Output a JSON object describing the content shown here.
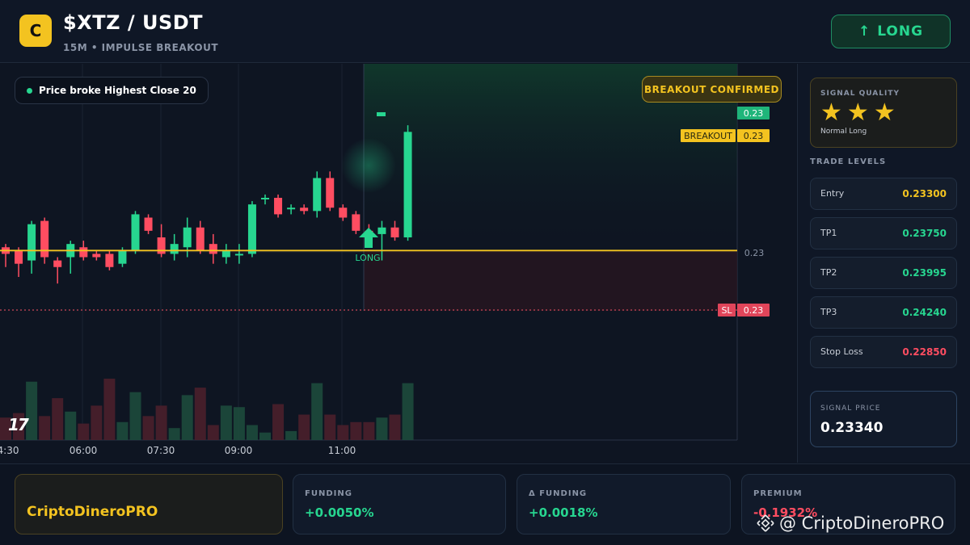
{
  "header": {
    "logo_letter": "C",
    "pair": "$XTZ / USDT",
    "subtitle": "15M • IMPULSE BREAKOUT",
    "long_button": "LONG",
    "long_arrow": "↑"
  },
  "chart": {
    "info_pill": "Price broke Highest Close 20",
    "confirmed_badge": "BREAKOUT CONFIRMED",
    "tv_logo": "17",
    "price_labels": {
      "top": "0.23",
      "breakout_tag": "BREAKOUT",
      "breakout": "0.23",
      "mid": "0.23",
      "sl_tag": "SL",
      "sl": "0.23"
    },
    "long_marker": "LONG",
    "time_labels": [
      "4:30",
      "06:00",
      "07:30",
      "09:00",
      "11:00"
    ]
  },
  "chart_data": {
    "type": "candlestick",
    "x": [
      "4:30",
      "06:00",
      "07:30",
      "09:00",
      "11:00"
    ],
    "series": [
      {
        "values": [
          {
            "o": 0.23305,
            "h": 0.2331,
            "l": 0.23275,
            "c": 0.23295
          },
          {
            "o": 0.233,
            "h": 0.23305,
            "l": 0.2326,
            "c": 0.2328
          },
          {
            "o": 0.23285,
            "h": 0.23345,
            "l": 0.23265,
            "c": 0.2334
          },
          {
            "o": 0.23345,
            "h": 0.2335,
            "l": 0.2328,
            "c": 0.2329
          },
          {
            "o": 0.23285,
            "h": 0.2329,
            "l": 0.2325,
            "c": 0.23275
          },
          {
            "o": 0.2329,
            "h": 0.23315,
            "l": 0.23265,
            "c": 0.2331
          },
          {
            "o": 0.23305,
            "h": 0.23315,
            "l": 0.23285,
            "c": 0.2329
          },
          {
            "o": 0.23295,
            "h": 0.233,
            "l": 0.23285,
            "c": 0.2329
          },
          {
            "o": 0.23295,
            "h": 0.233,
            "l": 0.2327,
            "c": 0.23275
          },
          {
            "o": 0.2328,
            "h": 0.23305,
            "l": 0.23275,
            "c": 0.233
          },
          {
            "o": 0.233,
            "h": 0.2336,
            "l": 0.23295,
            "c": 0.23355
          },
          {
            "o": 0.2335,
            "h": 0.23355,
            "l": 0.23325,
            "c": 0.2333
          },
          {
            "o": 0.2332,
            "h": 0.2334,
            "l": 0.2329,
            "c": 0.23295
          },
          {
            "o": 0.23295,
            "h": 0.23325,
            "l": 0.23285,
            "c": 0.2331
          },
          {
            "o": 0.23305,
            "h": 0.2335,
            "l": 0.2329,
            "c": 0.23335
          },
          {
            "o": 0.23335,
            "h": 0.23345,
            "l": 0.23295,
            "c": 0.233
          },
          {
            "o": 0.2331,
            "h": 0.23325,
            "l": 0.2328,
            "c": 0.23295
          },
          {
            "o": 0.2329,
            "h": 0.2331,
            "l": 0.2328,
            "c": 0.233
          },
          {
            "o": 0.23295,
            "h": 0.2331,
            "l": 0.2328,
            "c": 0.23295
          },
          {
            "o": 0.23295,
            "h": 0.23375,
            "l": 0.2329,
            "c": 0.2337
          },
          {
            "o": 0.2338,
            "h": 0.23385,
            "l": 0.2337,
            "c": 0.2338
          },
          {
            "o": 0.2338,
            "h": 0.23385,
            "l": 0.2335,
            "c": 0.23355
          },
          {
            "o": 0.23365,
            "h": 0.2337,
            "l": 0.23355,
            "c": 0.23365
          },
          {
            "o": 0.23365,
            "h": 0.2337,
            "l": 0.23355,
            "c": 0.2336
          },
          {
            "o": 0.2336,
            "h": 0.2342,
            "l": 0.2335,
            "c": 0.2341
          },
          {
            "o": 0.2341,
            "h": 0.2342,
            "l": 0.2336,
            "c": 0.23365
          },
          {
            "o": 0.23365,
            "h": 0.2337,
            "l": 0.23345,
            "c": 0.2335
          },
          {
            "o": 0.23355,
            "h": 0.2336,
            "l": 0.23325,
            "c": 0.2333
          },
          {
            "o": 0.2333,
            "h": 0.2334,
            "l": 0.2331,
            "c": 0.2332
          },
          {
            "o": 0.23325,
            "h": 0.23345,
            "l": 0.23285,
            "c": 0.23335
          },
          {
            "o": 0.23335,
            "h": 0.23345,
            "l": 0.23315,
            "c": 0.2332
          },
          {
            "o": 0.2332,
            "h": 0.2349,
            "l": 0.23315,
            "c": 0.2348
          }
        ]
      }
    ],
    "volume": [
      30,
      36,
      78,
      32,
      56,
      38,
      22,
      46,
      82,
      24,
      64,
      32,
      46,
      16,
      60,
      70,
      20,
      46,
      44,
      20,
      10,
      48,
      12,
      34,
      76,
      34,
      20,
      24,
      24,
      30,
      34,
      76
    ],
    "levels": {
      "breakout": 0.233,
      "stop_loss": 0.2285
    }
  },
  "panel": {
    "quality_label": "SIGNAL QUALITY",
    "stars": "★",
    "quality_note": "Normal Long",
    "levels_title": "TRADE LEVELS",
    "levels": [
      {
        "name": "Entry",
        "value": "0.23300",
        "color": "#f3c320"
      },
      {
        "name": "TP1",
        "value": "0.23750",
        "color": "#27d690"
      },
      {
        "name": "TP2",
        "value": "0.23995",
        "color": "#27d690"
      },
      {
        "name": "TP3",
        "value": "0.24240",
        "color": "#27d690"
      },
      {
        "name": "Stop Loss",
        "value": "0.22850",
        "color": "#ff4d61"
      }
    ],
    "signal_price_label": "SIGNAL PRICE",
    "signal_price": "0.23340"
  },
  "footer": {
    "brand": "CriptoDineroPRO",
    "cards": [
      {
        "label": "FUNDING",
        "value": "+0.0050%",
        "color": "#27d690"
      },
      {
        "label": "Δ FUNDING",
        "value": "+0.0018%",
        "color": "#27d690"
      },
      {
        "label": "PREMIUM",
        "value": "-0.1932%",
        "color": "#ff4d61"
      }
    ],
    "watermark": "@ CriptoDineroPRO"
  },
  "colors": {
    "up": "#27d690",
    "down": "#ff4d61",
    "accent": "#f3c320"
  }
}
